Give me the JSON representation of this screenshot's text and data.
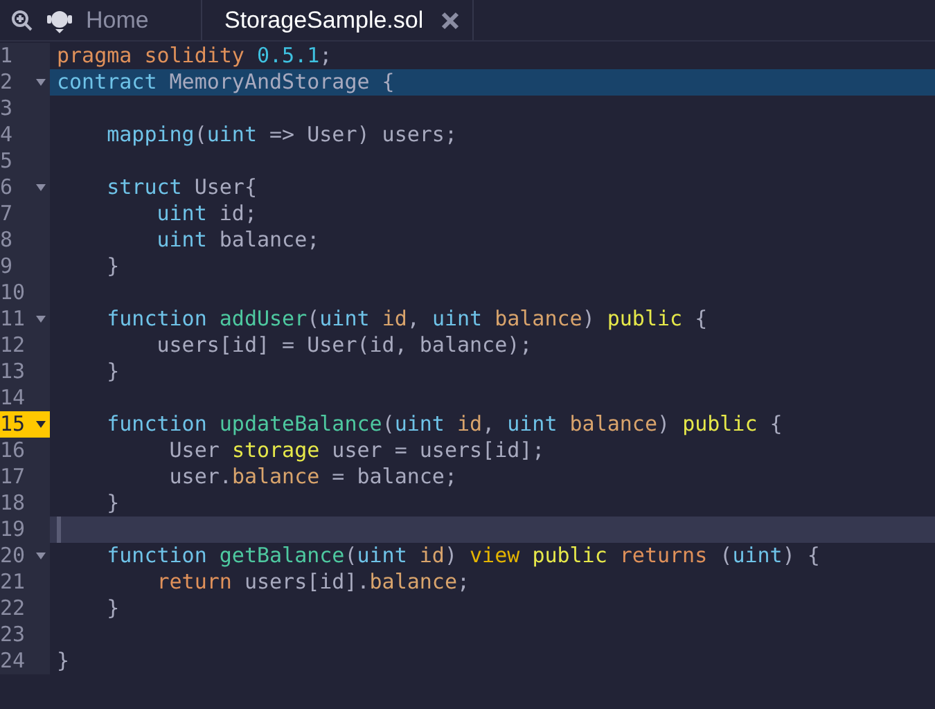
{
  "tabs": [
    {
      "label": "Home",
      "selected": false,
      "closable": false
    },
    {
      "label": "StorageSample.sol",
      "selected": true,
      "closable": true
    }
  ],
  "editor": {
    "lines": [
      {
        "number": "1",
        "foldable": false,
        "selected": false,
        "breakpoint": false,
        "current": false,
        "tokens": [
          {
            "kind": "keyword",
            "text": "pragma solidity "
          },
          {
            "kind": "number",
            "text": "0.5.1"
          },
          {
            "kind": "plain",
            "text": ";"
          }
        ]
      },
      {
        "number": "2",
        "foldable": true,
        "selected": true,
        "breakpoint": false,
        "current": false,
        "tokens": [
          {
            "kind": "type",
            "text": "contract "
          },
          {
            "kind": "plain",
            "text": "MemoryAndStorage {"
          }
        ]
      },
      {
        "number": "3",
        "foldable": false,
        "selected": false,
        "breakpoint": false,
        "current": false
      },
      {
        "number": "4",
        "foldable": false,
        "selected": false,
        "breakpoint": false,
        "current": false,
        "tokens": [
          {
            "kind": "type",
            "text": "    mapping"
          },
          {
            "kind": "plain",
            "text": "("
          },
          {
            "kind": "type",
            "text": "uint"
          },
          {
            "kind": "plain",
            "text": " => User) users;"
          }
        ]
      },
      {
        "number": "5",
        "foldable": false,
        "selected": false,
        "breakpoint": false,
        "current": false
      },
      {
        "number": "6",
        "foldable": true,
        "selected": false,
        "breakpoint": false,
        "current": false,
        "tokens": [
          {
            "kind": "type",
            "text": "    struct "
          },
          {
            "kind": "plain",
            "text": "User{"
          }
        ]
      },
      {
        "number": "7",
        "foldable": false,
        "selected": false,
        "breakpoint": false,
        "current": false,
        "tokens": [
          {
            "kind": "type",
            "text": "        uint"
          },
          {
            "kind": "plain",
            "text": " id;"
          }
        ]
      },
      {
        "number": "8",
        "foldable": false,
        "selected": false,
        "breakpoint": false,
        "current": false,
        "tokens": [
          {
            "kind": "type",
            "text": "        uint"
          },
          {
            "kind": "plain",
            "text": " balance;"
          }
        ]
      },
      {
        "number": "9",
        "foldable": false,
        "selected": false,
        "breakpoint": false,
        "current": false,
        "tokens": [
          {
            "kind": "plain",
            "text": "    }"
          }
        ]
      },
      {
        "number": "10",
        "foldable": false,
        "selected": false,
        "breakpoint": false,
        "current": false
      },
      {
        "number": "11",
        "foldable": true,
        "selected": false,
        "breakpoint": false,
        "current": false,
        "tokens": [
          {
            "kind": "type",
            "text": "    function "
          },
          {
            "kind": "function",
            "text": "addUser"
          },
          {
            "kind": "plain",
            "text": "("
          },
          {
            "kind": "type",
            "text": "uint "
          },
          {
            "kind": "param",
            "text": "id"
          },
          {
            "kind": "plain",
            "text": ", "
          },
          {
            "kind": "type",
            "text": "uint "
          },
          {
            "kind": "param",
            "text": "balance"
          },
          {
            "kind": "plain",
            "text": ") "
          },
          {
            "kind": "modifier",
            "text": "public"
          },
          {
            "kind": "plain",
            "text": " {"
          }
        ]
      },
      {
        "number": "12",
        "foldable": false,
        "selected": false,
        "breakpoint": false,
        "current": false,
        "tokens": [
          {
            "kind": "plain",
            "text": "        users[id] = User(id, balance);"
          }
        ]
      },
      {
        "number": "13",
        "foldable": false,
        "selected": false,
        "breakpoint": false,
        "current": false,
        "tokens": [
          {
            "kind": "plain",
            "text": "    }"
          }
        ]
      },
      {
        "number": "14",
        "foldable": false,
        "selected": false,
        "breakpoint": false,
        "current": false
      },
      {
        "number": "15",
        "foldable": true,
        "selected": false,
        "breakpoint": true,
        "current": false,
        "tokens": [
          {
            "kind": "type",
            "text": "    function "
          },
          {
            "kind": "function",
            "text": "updateBalance"
          },
          {
            "kind": "plain",
            "text": "("
          },
          {
            "kind": "type",
            "text": "uint "
          },
          {
            "kind": "param",
            "text": "id"
          },
          {
            "kind": "plain",
            "text": ", "
          },
          {
            "kind": "type",
            "text": "uint "
          },
          {
            "kind": "param",
            "text": "balance"
          },
          {
            "kind": "plain",
            "text": ") "
          },
          {
            "kind": "modifier",
            "text": "public"
          },
          {
            "kind": "plain",
            "text": " {"
          }
        ]
      },
      {
        "number": "16",
        "foldable": false,
        "selected": false,
        "breakpoint": false,
        "current": false,
        "tokens": [
          {
            "kind": "plain",
            "text": "         User "
          },
          {
            "kind": "modifier",
            "text": "storage"
          },
          {
            "kind": "plain",
            "text": " user = users[id];"
          }
        ]
      },
      {
        "number": "17",
        "foldable": false,
        "selected": false,
        "breakpoint": false,
        "current": false,
        "tokens": [
          {
            "kind": "plain",
            "text": "         user."
          },
          {
            "kind": "param",
            "text": "balance"
          },
          {
            "kind": "plain",
            "text": " = balance;"
          }
        ]
      },
      {
        "number": "18",
        "foldable": false,
        "selected": false,
        "breakpoint": false,
        "current": false,
        "tokens": [
          {
            "kind": "plain",
            "text": "    }"
          }
        ]
      },
      {
        "number": "19",
        "foldable": false,
        "selected": false,
        "breakpoint": false,
        "current": true
      },
      {
        "number": "20",
        "foldable": true,
        "selected": false,
        "breakpoint": false,
        "current": false,
        "tokens": [
          {
            "kind": "type",
            "text": "    function "
          },
          {
            "kind": "function",
            "text": "getBalance"
          },
          {
            "kind": "plain",
            "text": "("
          },
          {
            "kind": "type",
            "text": "uint "
          },
          {
            "kind": "param",
            "text": "id"
          },
          {
            "kind": "plain",
            "text": ") "
          },
          {
            "kind": "view",
            "text": "view "
          },
          {
            "kind": "modifier",
            "text": "public "
          },
          {
            "kind": "keyword",
            "text": "returns"
          },
          {
            "kind": "plain",
            "text": " ("
          },
          {
            "kind": "type",
            "text": "uint"
          },
          {
            "kind": "plain",
            "text": ") {"
          }
        ]
      },
      {
        "number": "21",
        "foldable": false,
        "selected": false,
        "breakpoint": false,
        "current": false,
        "tokens": [
          {
            "kind": "keyword",
            "text": "        return"
          },
          {
            "kind": "plain",
            "text": " users[id]."
          },
          {
            "kind": "param",
            "text": "balance"
          },
          {
            "kind": "plain",
            "text": ";"
          }
        ]
      },
      {
        "number": "22",
        "foldable": false,
        "selected": false,
        "breakpoint": false,
        "current": false,
        "tokens": [
          {
            "kind": "plain",
            "text": "    }"
          }
        ]
      },
      {
        "number": "23",
        "foldable": false,
        "selected": false,
        "breakpoint": false,
        "current": false
      },
      {
        "number": "24",
        "foldable": false,
        "selected": false,
        "breakpoint": false,
        "current": false,
        "tokens": [
          {
            "kind": "plain",
            "text": "}"
          }
        ]
      }
    ]
  }
}
